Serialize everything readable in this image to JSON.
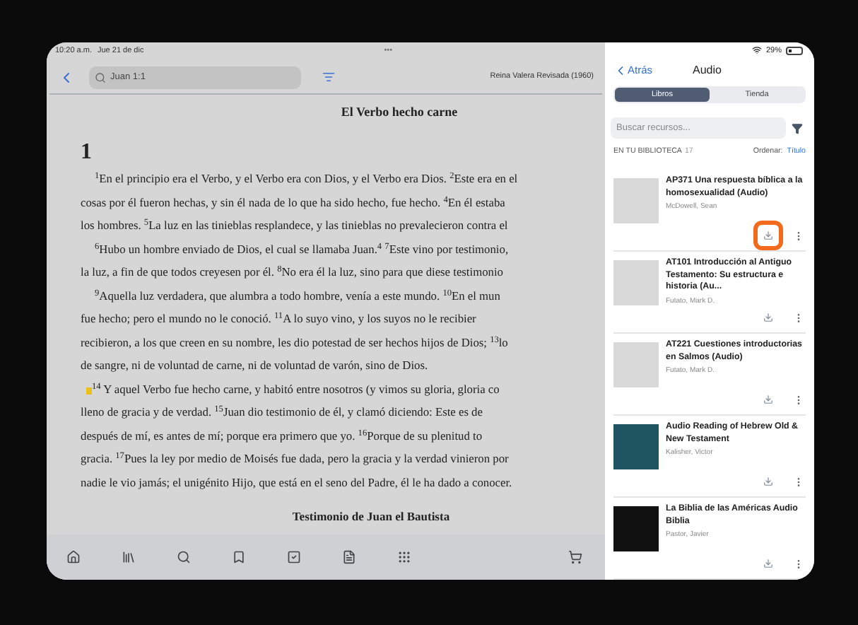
{
  "status_bar": {
    "time": "10:20 a.m.",
    "date": "Jue 21 de dic",
    "dots": "•••",
    "battery": "29%"
  },
  "reader": {
    "search": {
      "value": "Juan 1:1"
    },
    "version": "Reina Valera Revisada (1960)",
    "heading": "El Verbo hecho carne",
    "chapter": "1",
    "paragraphs": [
      {
        "marker": false,
        "lines": [
          "$^{1}$En el principio era el Verbo, y el Verbo era con Dios, y el Verbo era Dios. $^{2}$Este era en el",
          "cosas por él fueron hechas, y sin él nada de lo que ha sido hecho, fue hecho. $^{4}$En él estaba",
          "los hombres. $^{5}$La luz en las tinieblas resplandece, y las tinieblas no prevalecieron contra el"
        ]
      },
      {
        "marker": false,
        "lines": [
          "$^{6}$Hubo un hombre enviado de Dios, el cual se llamaba Juan.$^{4}$ $^{7}$Este vino por testimonio,",
          "la luz, a fin de que todos creyesen por él. $^{8}$No era él la luz, sino para que diese testimonio"
        ]
      },
      {
        "marker": false,
        "lines": [
          "$^{9}$Aquella luz verdadera, que alumbra a todo hombre, venía a este mundo. $^{10}$En el mun",
          "fue hecho; pero el mundo no le conoció. $^{11}$A lo suyo vino, y los suyos no le recibier",
          "recibieron, a los que creen en su nombre, les dio potestad de ser hechos hijos de Dios; $^{13}$lo",
          "de sangre, ni de voluntad de carne, ni de voluntad de varón, sino de Dios."
        ]
      },
      {
        "marker": true,
        "lines": [
          "$^{14}$ Y aquel Verbo fue hecho carne, y habitó entre nosotros (y vimos su gloria, gloria co",
          "lleno de gracia y de verdad. $^{15}$Juan dio testimonio de él, y clamó diciendo: Este es de",
          "después de mí, es antes de mí; porque era primero que yo. $^{16}$Porque de su plenitud to",
          "gracia. $^{17}$Pues la ley por medio de Moisés fue dada, pero la gracia y la verdad vinieron por",
          "nadie le vio jamás; el unigénito Hijo, que está en el seno del Padre, él le ha dado a conocer."
        ]
      }
    ],
    "subheading": "Testimonio de Juan el Bautista"
  },
  "panel": {
    "back": "Atrás",
    "title": "Audio",
    "tabs": [
      {
        "label": "Libros",
        "selected": true
      },
      {
        "label": "Tienda",
        "selected": false
      }
    ],
    "search": {
      "placeholder": "Buscar recursos..."
    },
    "library_label": "EN TU BIBLIOTECA",
    "count": "17",
    "sort_label": "Ordenar:",
    "sort_value": "Título",
    "items": [
      {
        "title": "AP371 Una respuesta bíblica a la homosexualidad (Audio)",
        "author": "McDowell, Sean",
        "color": "#d9d9d9",
        "highlighted": true
      },
      {
        "title": "AT101 Introducción al Antiguo Testamento: Su estructura e historia (Au...",
        "author": "Futato, Mark D.",
        "color": "#d9d9d9",
        "highlighted": false
      },
      {
        "title": "AT221 Cuestiones introductorias en Salmos (Audio)",
        "author": "Futato, Mark D.",
        "color": "#d9d9d9",
        "highlighted": false
      },
      {
        "title": "Audio Reading of Hebrew Old & New Testament",
        "author": "Kalisher, Victor",
        "color": "#1f5560",
        "highlighted": false
      },
      {
        "title": "La Biblia de las Américas Audio Biblia",
        "author": "Pastor, Javier",
        "color": "#111111",
        "highlighted": false
      }
    ]
  }
}
